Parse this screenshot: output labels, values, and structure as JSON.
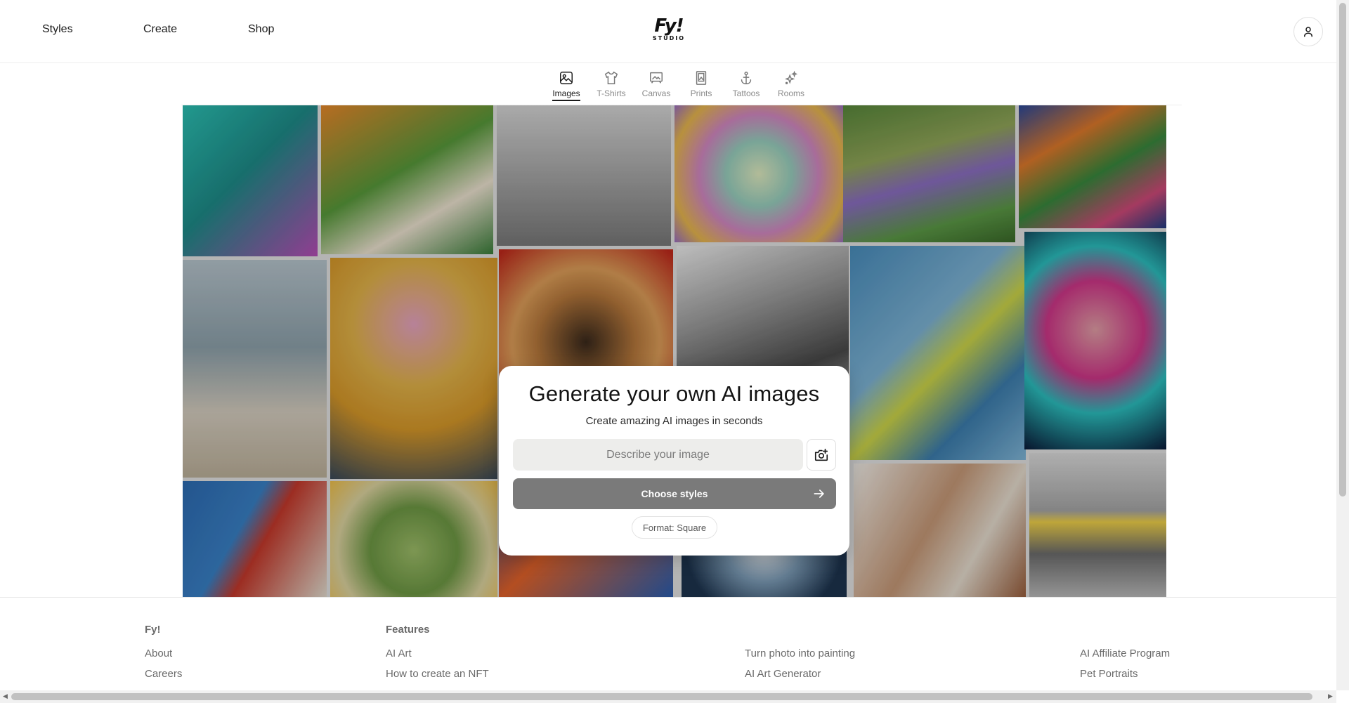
{
  "header": {
    "nav": [
      {
        "label": "Styles"
      },
      {
        "label": "Create"
      },
      {
        "label": "Shop"
      }
    ],
    "brand": {
      "mark": "Fy!",
      "sub": "STUDIO"
    }
  },
  "tabs": [
    {
      "label": "Images",
      "icon": "image-icon",
      "active": true
    },
    {
      "label": "T-Shirts",
      "icon": "tshirt-icon",
      "active": false
    },
    {
      "label": "Canvas",
      "icon": "canvas-icon",
      "active": false
    },
    {
      "label": "Prints",
      "icon": "print-frame-icon",
      "active": false
    },
    {
      "label": "Tattoos",
      "icon": "anchor-icon",
      "active": false
    },
    {
      "label": "Rooms",
      "icon": "sparkles-icon",
      "active": false
    }
  ],
  "card": {
    "title": "Generate your own AI images",
    "subtitle": "Create amazing AI images in seconds",
    "prompt_placeholder": "Describe your image",
    "prompt_value": "",
    "cta_label": "Choose styles",
    "format_label": "Format: Square"
  },
  "footer": {
    "col1": {
      "heading": "Fy!",
      "links": [
        "About",
        "Careers"
      ]
    },
    "col2": {
      "heading": "Features",
      "links": [
        "AI Art",
        "How to create an NFT"
      ]
    },
    "col3": {
      "links": [
        "Turn photo into painting",
        "AI Art Generator"
      ]
    },
    "col4": {
      "links": [
        "AI Affiliate Program",
        "Pet Portraits"
      ]
    }
  },
  "colors": {
    "accent_button": "#7a7a7a",
    "page_bg": "#ffffff",
    "text": "#1a1a1a",
    "muted": "#6a6a6a"
  }
}
